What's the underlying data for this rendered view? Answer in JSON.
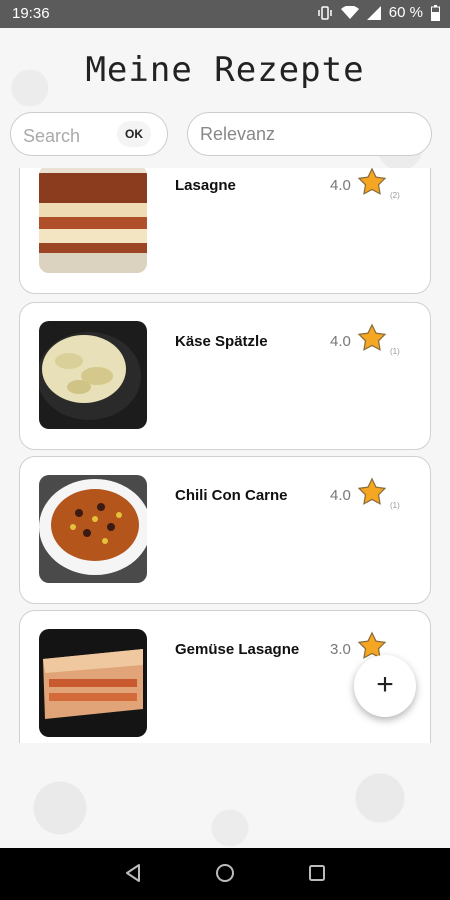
{
  "status_bar": {
    "time": "19:36",
    "battery": "60 %"
  },
  "page": {
    "title": "Meine Rezepte"
  },
  "search": {
    "placeholder": "Search",
    "ok_label": "OK"
  },
  "sort": {
    "value": "Relevanz"
  },
  "recipes": [
    {
      "name": "Lasagne",
      "rating": "4.0",
      "count": "(2)"
    },
    {
      "name": "Käse Spätzle",
      "rating": "4.0",
      "count": "(1)"
    },
    {
      "name": "Chili Con Carne",
      "rating": "4.0",
      "count": "(1)"
    },
    {
      "name": "Gemüse Lasagne",
      "rating": "3.0",
      "count": ""
    }
  ],
  "fab": {
    "label": "+"
  },
  "colors": {
    "star": "#f5a623",
    "star_outline": "#8a6d3b"
  }
}
